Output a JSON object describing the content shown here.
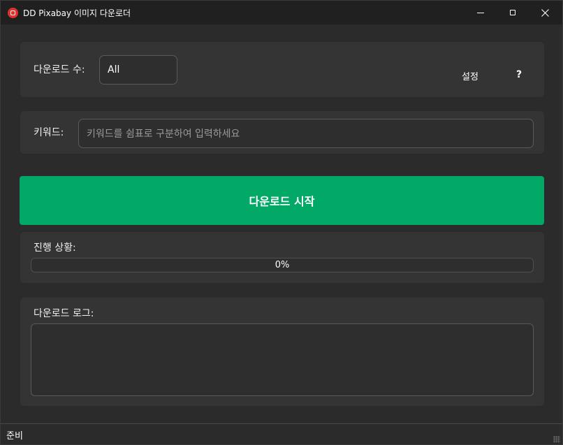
{
  "window": {
    "title": "DD Pixabay 이미지 다운로더",
    "icon": "app-logo-icon",
    "controls": [
      "minimize-icon",
      "maximize-icon",
      "close-icon"
    ]
  },
  "settings_panel": {
    "count_label": "다운로드 수:",
    "count_value": "All",
    "settings_button": "설정",
    "help_button": "?"
  },
  "keyword_panel": {
    "label": "키워드:",
    "placeholder": "키워드를 쉼표로 구분하여 입력하세요"
  },
  "download_button": {
    "label": "다운로드 시작",
    "color": "#02a866"
  },
  "progress_panel": {
    "label": "진행 상황:",
    "value_text": "0%",
    "fraction": 0.0
  },
  "log_panel": {
    "label": "다운로드 로그:",
    "content": ""
  },
  "status_bar": {
    "text": "준비"
  }
}
